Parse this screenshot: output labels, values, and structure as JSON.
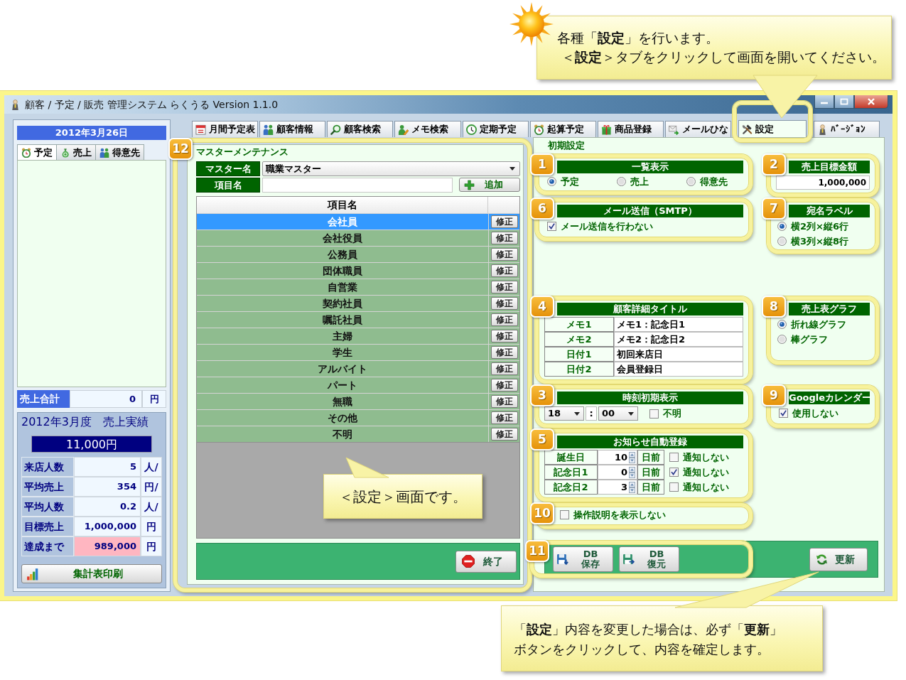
{
  "top_callout": {
    "lines": [
      "各種「**設定**」を行います。",
      "＜**設定**＞タブをクリックして画面を開いてください。"
    ]
  },
  "window": {
    "title": "顧客 / 予定 / 販売 管理システム らくうる Version 1.1.0"
  },
  "side_panel": {
    "date": "2012年3月26日",
    "tabs": [
      {
        "label": "予定",
        "selected": true
      },
      {
        "label": "売上",
        "selected": false
      },
      {
        "label": "得意先",
        "selected": false
      }
    ],
    "sales_total": {
      "label": "売上合計",
      "value": "0",
      "unit": "円"
    },
    "monthly": {
      "title": "2012年3月度　売上実績",
      "total": "11,000円",
      "rows": [
        {
          "label": "来店人数",
          "value": "5",
          "unit": "人/",
          "highlighted": false
        },
        {
          "label": "平均売上",
          "value": "354",
          "unit": "円/",
          "highlighted": false
        },
        {
          "label": "平均人数",
          "value": "0.2",
          "unit": "人/",
          "highlighted": false
        },
        {
          "label": "目標売上",
          "value": "1,000,000",
          "unit": "円",
          "highlighted": false
        },
        {
          "label": "達成まで",
          "value": "989,000",
          "unit": "円",
          "highlighted": true
        }
      ],
      "print_button": "集計表印刷"
    }
  },
  "tabs": [
    {
      "label": "月間予定表",
      "selected": false,
      "highlighted": false
    },
    {
      "label": "顧客情報",
      "selected": false,
      "highlighted": false
    },
    {
      "label": "顧客検索",
      "selected": false,
      "highlighted": false
    },
    {
      "label": "メモ検索",
      "selected": false,
      "highlighted": false
    },
    {
      "label": "定期予定",
      "selected": false,
      "highlighted": false
    },
    {
      "label": "起算予定",
      "selected": false,
      "highlighted": false
    },
    {
      "label": "商品登録",
      "selected": false,
      "highlighted": false
    },
    {
      "label": "メールひな",
      "selected": false,
      "highlighted": false
    },
    {
      "label": "設定",
      "selected": true,
      "highlighted": true
    },
    {
      "label": "ﾊﾞｰｼﾞｮﾝ",
      "selected": false,
      "highlighted": false
    }
  ],
  "master": {
    "badge": "12",
    "title": "マスターメンテナンス",
    "master_label": "マスター名",
    "master_value": "職業マスター",
    "item_label": "項目名",
    "add_button": "追加",
    "column": "項目名",
    "rows": [
      {
        "name": "会社員",
        "selected": true,
        "button": "修正"
      },
      {
        "name": "会社役員",
        "selected": false,
        "button": "修正"
      },
      {
        "name": "公務員",
        "selected": false,
        "button": "修正"
      },
      {
        "name": "団体職員",
        "selected": false,
        "button": "修正"
      },
      {
        "name": "自営業",
        "selected": false,
        "button": "修正"
      },
      {
        "name": "契約社員",
        "selected": false,
        "button": "修正"
      },
      {
        "name": "嘱託社員",
        "selected": false,
        "button": "修正"
      },
      {
        "name": "主婦",
        "selected": false,
        "button": "修正"
      },
      {
        "name": "学生",
        "selected": false,
        "button": "修正"
      },
      {
        "name": "アルバイト",
        "selected": false,
        "button": "修正"
      },
      {
        "name": "パート",
        "selected": false,
        "button": "修正"
      },
      {
        "name": "無職",
        "selected": false,
        "button": "修正"
      },
      {
        "name": "その他",
        "selected": false,
        "button": "修正"
      },
      {
        "name": "不明",
        "selected": false,
        "button": "修正"
      }
    ],
    "close_button": "終了"
  },
  "center_callout": {
    "text": "＜設定＞画面です。"
  },
  "settings": {
    "title": "初期設定",
    "list_display": {
      "badge": "1",
      "title": "一覧表示",
      "options": [
        {
          "label": "予定",
          "selected": true
        },
        {
          "label": "売上",
          "selected": false
        },
        {
          "label": "得意先",
          "selected": false
        }
      ]
    },
    "sales_target": {
      "badge": "2",
      "title": "売上目標金額",
      "value": "1,000,000"
    },
    "mail": {
      "badge": "6",
      "title": "メール送信（SMTP）",
      "option": {
        "label": "メール送信を行わない",
        "checked": true
      }
    },
    "address_label": {
      "badge": "7",
      "title": "宛名ラベル",
      "options": [
        {
          "label": "横2列×縦6行",
          "selected": true
        },
        {
          "label": "横3列×縦8行",
          "selected": false
        }
      ]
    },
    "detail_titles": {
      "badge": "4",
      "title": "顧客詳細タイトル",
      "rows": [
        {
          "label": "メモ1",
          "value": "メモ1：記念日1"
        },
        {
          "label": "メモ2",
          "value": "メモ2：記念日2"
        },
        {
          "label": "日付1",
          "value": "初回来店日"
        },
        {
          "label": "日付2",
          "value": "会員登録日"
        }
      ]
    },
    "sales_graph": {
      "badge": "8",
      "title": "売上表グラフ",
      "options": [
        {
          "label": "折れ線グラフ",
          "selected": true
        },
        {
          "label": "棒グラフ",
          "selected": false
        }
      ]
    },
    "time_default": {
      "badge": "3",
      "title": "時刻初期表示",
      "hour": "18",
      "separator": ":",
      "minute": "00",
      "option": {
        "label": "不明",
        "checked": false
      }
    },
    "google_calendar": {
      "badge": "9",
      "title": "Googleカレンダー",
      "option": {
        "label": "使用しない",
        "checked": true
      }
    },
    "notices": {
      "badge": "5",
      "title": "お知らせ自動登録",
      "rows": [
        {
          "label": "誕生日",
          "days": "10",
          "unit": "日前",
          "option": {
            "label": "通知しない",
            "checked": false
          }
        },
        {
          "label": "記念日1",
          "days": "0",
          "unit": "日前",
          "option": {
            "label": "通知しない",
            "checked": true
          }
        },
        {
          "label": "記念日2",
          "days": "3",
          "unit": "日前",
          "option": {
            "label": "通知しない",
            "checked": false
          }
        }
      ]
    },
    "hide_help": {
      "badge": "10",
      "option": {
        "label": "操作説明を表示しない",
        "checked": false
      }
    },
    "db": {
      "badge": "11",
      "buttons": [
        {
          "lines": [
            "DB",
            "保存"
          ]
        },
        {
          "lines": [
            "DB",
            "復元"
          ]
        }
      ]
    },
    "update_button": "更新"
  },
  "bottom_callout": {
    "lines": [
      "「**設定**」内容を変更した場合は、必ず「**更新**」",
      "ボタンをクリックして、内容を確定します。"
    ]
  }
}
